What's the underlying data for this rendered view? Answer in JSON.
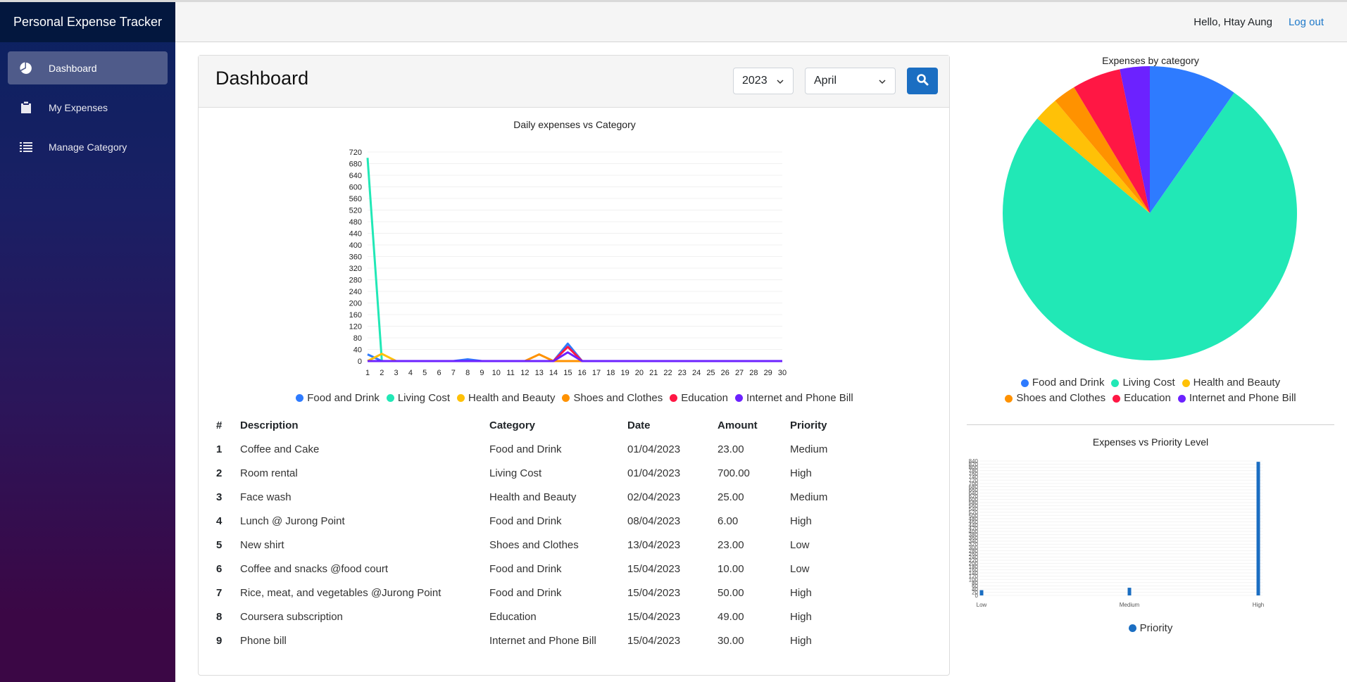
{
  "app": {
    "title": "Personal Expense Tracker"
  },
  "sidebar": {
    "items": [
      {
        "label": "Dashboard",
        "icon": "pie-chart-icon",
        "active": true
      },
      {
        "label": "My Expenses",
        "icon": "clipboard-icon",
        "active": false
      },
      {
        "label": "Manage Category",
        "icon": "list-icon",
        "active": false
      }
    ]
  },
  "header": {
    "greeting": "Hello, Htay Aung",
    "logout_label": "Log out"
  },
  "dashboard": {
    "title": "Dashboard",
    "filters": {
      "year": "2023",
      "month": "April",
      "search_icon": "search-icon"
    }
  },
  "colors": {
    "Food and Drink": "#2e7bff",
    "Living Cost": "#21e8b6",
    "Health and Beauty": "#ffc107",
    "Shoes and Clothes": "#ff9200",
    "Education": "#ff1744",
    "Internet and Phone Bill": "#6c22ff",
    "sidebar_top": "#03173e",
    "sidebar_bottom": "#3b0745",
    "primary": "#1b6ec2"
  },
  "table": {
    "headers": [
      "#",
      "Description",
      "Category",
      "Date",
      "Amount",
      "Priority"
    ],
    "rows": [
      [
        "1",
        "Coffee and Cake",
        "Food and Drink",
        "01/04/2023",
        "23.00",
        "Medium"
      ],
      [
        "2",
        "Room rental",
        "Living Cost",
        "01/04/2023",
        "700.00",
        "High"
      ],
      [
        "3",
        "Face wash",
        "Health and Beauty",
        "02/04/2023",
        "25.00",
        "Medium"
      ],
      [
        "4",
        "Lunch @ Jurong Point",
        "Food and Drink",
        "08/04/2023",
        "6.00",
        "High"
      ],
      [
        "5",
        "New shirt",
        "Shoes and Clothes",
        "13/04/2023",
        "23.00",
        "Low"
      ],
      [
        "6",
        "Coffee and snacks @food court",
        "Food and Drink",
        "15/04/2023",
        "10.00",
        "Low"
      ],
      [
        "7",
        "Rice, meat, and vegetables @Jurong Point",
        "Food and Drink",
        "15/04/2023",
        "50.00",
        "High"
      ],
      [
        "8",
        "Coursera subscription",
        "Education",
        "15/04/2023",
        "49.00",
        "High"
      ],
      [
        "9",
        "Phone bill",
        "Internet and Phone Bill",
        "15/04/2023",
        "30.00",
        "High"
      ]
    ]
  },
  "chart_data": [
    {
      "type": "line",
      "title": "Daily expenses vs Category",
      "xlabel": "",
      "ylabel": "",
      "x": [
        1,
        2,
        3,
        4,
        5,
        6,
        7,
        8,
        9,
        10,
        11,
        12,
        13,
        14,
        15,
        16,
        17,
        18,
        19,
        20,
        21,
        22,
        23,
        24,
        25,
        26,
        27,
        28,
        29,
        30
      ],
      "ylim": [
        0,
        720
      ],
      "yticks": [
        0,
        40,
        80,
        120,
        160,
        200,
        240,
        280,
        320,
        360,
        400,
        440,
        480,
        520,
        560,
        600,
        640,
        680,
        720
      ],
      "grid": true,
      "legend": "bottom",
      "series": [
        {
          "name": "Food and Drink",
          "values": [
            23,
            0,
            0,
            0,
            0,
            0,
            0,
            6,
            0,
            0,
            0,
            0,
            0,
            0,
            60,
            0,
            0,
            0,
            0,
            0,
            0,
            0,
            0,
            0,
            0,
            0,
            0,
            0,
            0,
            0
          ]
        },
        {
          "name": "Living Cost",
          "values": [
            700,
            0,
            0,
            0,
            0,
            0,
            0,
            0,
            0,
            0,
            0,
            0,
            0,
            0,
            0,
            0,
            0,
            0,
            0,
            0,
            0,
            0,
            0,
            0,
            0,
            0,
            0,
            0,
            0,
            0
          ]
        },
        {
          "name": "Health and Beauty",
          "values": [
            0,
            25,
            0,
            0,
            0,
            0,
            0,
            0,
            0,
            0,
            0,
            0,
            0,
            0,
            0,
            0,
            0,
            0,
            0,
            0,
            0,
            0,
            0,
            0,
            0,
            0,
            0,
            0,
            0,
            0
          ]
        },
        {
          "name": "Shoes and Clothes",
          "values": [
            0,
            0,
            0,
            0,
            0,
            0,
            0,
            0,
            0,
            0,
            0,
            0,
            23,
            0,
            0,
            0,
            0,
            0,
            0,
            0,
            0,
            0,
            0,
            0,
            0,
            0,
            0,
            0,
            0,
            0
          ]
        },
        {
          "name": "Education",
          "values": [
            0,
            0,
            0,
            0,
            0,
            0,
            0,
            0,
            0,
            0,
            0,
            0,
            0,
            0,
            49,
            0,
            0,
            0,
            0,
            0,
            0,
            0,
            0,
            0,
            0,
            0,
            0,
            0,
            0,
            0
          ]
        },
        {
          "name": "Internet and Phone Bill",
          "values": [
            0,
            0,
            0,
            0,
            0,
            0,
            0,
            0,
            0,
            0,
            0,
            0,
            0,
            0,
            30,
            0,
            0,
            0,
            0,
            0,
            0,
            0,
            0,
            0,
            0,
            0,
            0,
            0,
            0,
            0
          ]
        }
      ]
    },
    {
      "type": "pie",
      "title": "Expenses by category",
      "legend": "bottom",
      "categories": [
        "Food and Drink",
        "Living Cost",
        "Health and Beauty",
        "Shoes and Clothes",
        "Education",
        "Internet and Phone Bill"
      ],
      "values": [
        89,
        700,
        25,
        23,
        49,
        30
      ]
    },
    {
      "type": "bar",
      "title": "Expenses vs Priority Level",
      "categories": [
        "Low",
        "Medium",
        "High"
      ],
      "series": [
        {
          "name": "Priority",
          "values": [
            33,
            48,
            835
          ]
        }
      ],
      "ylim": [
        0,
        840
      ],
      "ytick_step": 20,
      "grid": true,
      "legend": "bottom"
    }
  ]
}
